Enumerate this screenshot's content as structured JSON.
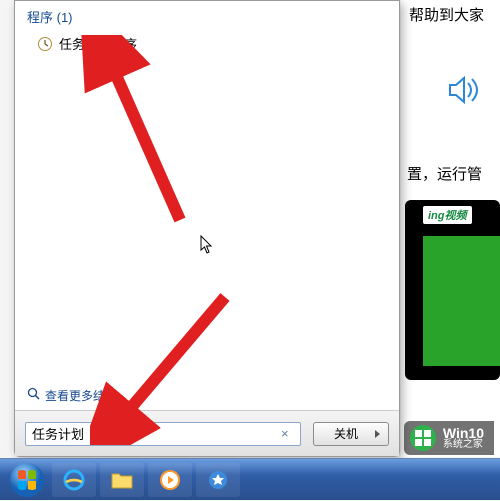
{
  "startMenu": {
    "category": "程序 (1)",
    "items": [
      {
        "label": "任务计划程序",
        "icon": "clock"
      }
    ],
    "seeMore": "查看更多结果",
    "search": {
      "value": "任务计划",
      "clear": "×"
    },
    "shutdown": "关机"
  },
  "rightPane": {
    "line1": "帮助到大家",
    "line2": "置，运行管",
    "videoBadge": "ing视频"
  },
  "watermark": {
    "title": "Win10",
    "subtitle": "系统之家"
  },
  "icons": {
    "taskScheduler": "clock-icon",
    "magnifier": "magnifier-icon",
    "speaker": "speaker-icon"
  }
}
